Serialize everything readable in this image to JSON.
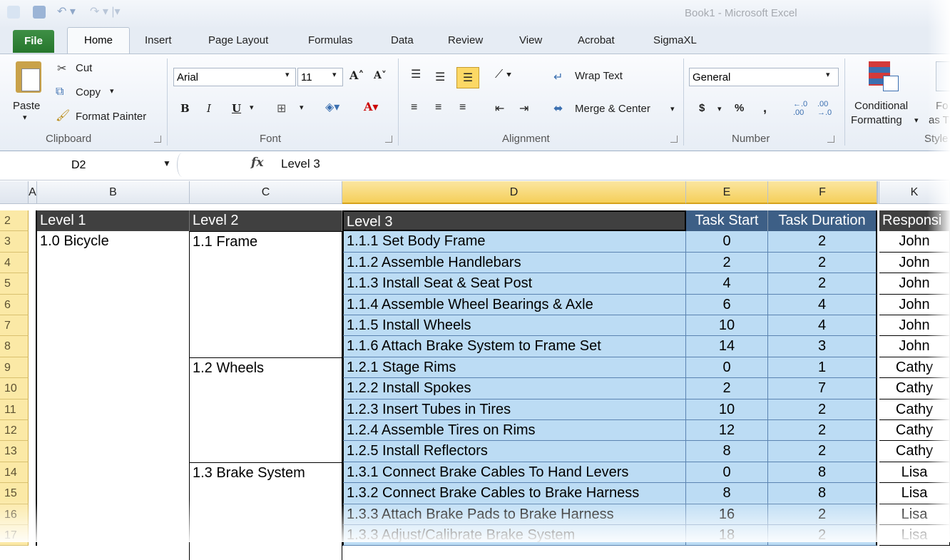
{
  "window": {
    "title": "Book1 - Microsoft Excel"
  },
  "tabs": [
    "File",
    "Home",
    "Insert",
    "Page Layout",
    "Formulas",
    "Data",
    "Review",
    "View",
    "Acrobat",
    "SigmaXL"
  ],
  "ribbon": {
    "clipboard": {
      "label": "Clipboard",
      "paste": "Paste",
      "cut": "Cut",
      "copy": "Copy",
      "copy_arrow": "▾",
      "format_painter": "Format Painter"
    },
    "font": {
      "label": "Font",
      "name": "Arial",
      "size": "11",
      "bold": "B",
      "italic": "I",
      "underline": "U"
    },
    "alignment": {
      "label": "Alignment",
      "wrap_text": "Wrap Text",
      "merge_center": "Merge & Center"
    },
    "number": {
      "label": "Number",
      "format": "General",
      "currency": "$",
      "percent": "%",
      "comma": ","
    },
    "styles": {
      "label": "Style",
      "conditional": "Conditional",
      "formatting": "Formatting",
      "format_as": "Fo",
      "as_table": "as T"
    }
  },
  "formula_bar": {
    "name_box": "D2",
    "fx": "fx",
    "value": "Level 3"
  },
  "columns": [
    "A",
    "B",
    "C",
    "D",
    "E",
    "F",
    "K"
  ],
  "row_numbers": [
    "2",
    "3",
    "4",
    "5",
    "6",
    "7",
    "8",
    "9",
    "10",
    "11",
    "12",
    "13",
    "14",
    "15",
    "16",
    "17"
  ],
  "headers": {
    "level1": "Level 1",
    "level2": "Level 2",
    "level3": "Level 3",
    "start": "Task Start",
    "duration": "Task Duration",
    "resp": "Responsi"
  },
  "level1": "1.0 Bicycle",
  "level2": [
    "1.1 Frame",
    "1.2 Wheels",
    "1.3 Brake System"
  ],
  "tasks": [
    {
      "name": "1.1.1 Set Body Frame",
      "start": "0",
      "duration": "2",
      "resp": "John"
    },
    {
      "name": "1.1.2 Assemble Handlebars",
      "start": "2",
      "duration": "2",
      "resp": "John"
    },
    {
      "name": "1.1.3 Install Seat & Seat Post",
      "start": "4",
      "duration": "2",
      "resp": "John"
    },
    {
      "name": "1.1.4 Assemble Wheel Bearings & Axle",
      "start": "6",
      "duration": "4",
      "resp": "John"
    },
    {
      "name": "1.1.5 Install Wheels",
      "start": "10",
      "duration": "4",
      "resp": "John"
    },
    {
      "name": "1.1.6 Attach Brake System to Frame Set",
      "start": "14",
      "duration": "3",
      "resp": "John"
    },
    {
      "name": "1.2.1 Stage Rims",
      "start": "0",
      "duration": "1",
      "resp": "Cathy"
    },
    {
      "name": "1.2.2 Install Spokes",
      "start": "2",
      "duration": "7",
      "resp": "Cathy"
    },
    {
      "name": "1.2.3 Insert Tubes in Tires",
      "start": "10",
      "duration": "2",
      "resp": "Cathy"
    },
    {
      "name": "1.2.4 Assemble Tires on Rims",
      "start": "12",
      "duration": "2",
      "resp": "Cathy"
    },
    {
      "name": "1.2.5 Install Reflectors",
      "start": "8",
      "duration": "2",
      "resp": "Cathy"
    },
    {
      "name": "1.3.1 Connect Brake Cables To Hand Levers",
      "start": "0",
      "duration": "8",
      "resp": "Lisa"
    },
    {
      "name": "1.3.2 Connect Brake Cables to Brake Harness",
      "start": "8",
      "duration": "8",
      "resp": "Lisa"
    },
    {
      "name": "1.3.3 Attach Brake Pads to Brake Harness",
      "start": "16",
      "duration": "2",
      "resp": "Lisa"
    },
    {
      "name": "1.3.3 Adjust/Calibrate Brake System",
      "start": "18",
      "duration": "2",
      "resp": "Lisa"
    }
  ]
}
